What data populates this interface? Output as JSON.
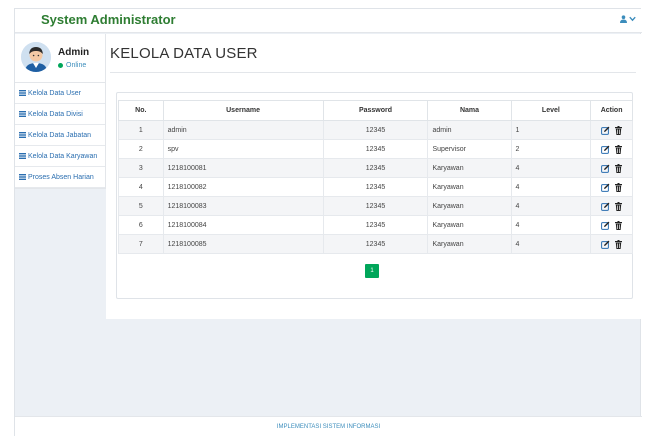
{
  "header": {
    "brand": "System Administrator"
  },
  "user": {
    "name": "Admin",
    "status": "Online"
  },
  "sidebar": {
    "items": [
      {
        "label": "Kelola Data User"
      },
      {
        "label": "Kelola Data Divisi"
      },
      {
        "label": "Kelola Data Jabatan"
      },
      {
        "label": "Kelola Data Karyawan"
      },
      {
        "label": "Proses Absen Harian"
      }
    ]
  },
  "main": {
    "title": "KELOLA DATA USER",
    "columns": [
      "No.",
      "Username",
      "Password",
      "Nama",
      "Level",
      "Action"
    ],
    "rows": [
      [
        "1",
        "admin",
        "12345",
        "admin",
        "1"
      ],
      [
        "2",
        "spv",
        "12345",
        "Supervisor",
        "2"
      ],
      [
        "3",
        "1218100081",
        "12345",
        "Karyawan",
        "4"
      ],
      [
        "4",
        "1218100082",
        "12345",
        "Karyawan",
        "4"
      ],
      [
        "5",
        "1218100083",
        "12345",
        "Karyawan",
        "4"
      ],
      [
        "6",
        "1218100084",
        "12345",
        "Karyawan",
        "4"
      ],
      [
        "7",
        "1218100085",
        "12345",
        "Karyawan",
        "4"
      ]
    ],
    "pagination": {
      "current": "1"
    }
  },
  "footer": {
    "text": "IMPLEMENTASI SISTEM INFORMASI"
  },
  "colors": {
    "brand": "#2e7d32",
    "link": "#2a6eb0",
    "online": "#00a65a",
    "page_active": "#00a65a"
  },
  "icons": {
    "user_menu": "user-icon",
    "menu_item": "list-icon",
    "edit": "edit-icon",
    "delete": "trash-icon"
  }
}
